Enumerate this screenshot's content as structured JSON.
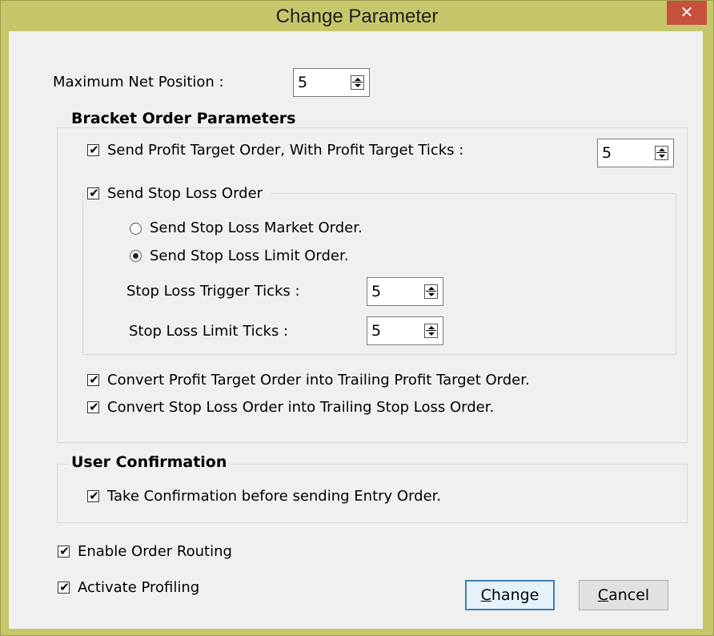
{
  "window": {
    "title": "Change Parameter",
    "close_glyph": "✕",
    "frame_color": "#c8c66a"
  },
  "max_net_position": {
    "label": "Maximum Net Position :",
    "value": "5"
  },
  "bracket": {
    "legend": "Bracket Order Parameters",
    "profit_target": {
      "label": "Send Profit Target Order, With Profit Target Ticks :",
      "checked": true,
      "ticks": "5"
    },
    "stop_loss": {
      "label": "Send Stop Loss Order",
      "checked": true,
      "market_label": "Send Stop Loss Market Order.",
      "market_selected": false,
      "limit_label": "Send Stop Loss Limit Order.",
      "limit_selected": true,
      "trigger_label": "Stop Loss Trigger Ticks :",
      "trigger_value": "5",
      "limit_ticks_label": "Stop Loss Limit Ticks :",
      "limit_ticks_value": "5"
    },
    "trailing_profit": {
      "label": "Convert Profit Target Order into Trailing Profit Target Order.",
      "checked": true
    },
    "trailing_stop": {
      "label": "Convert Stop Loss Order into Trailing Stop Loss Order.",
      "checked": true
    }
  },
  "confirmation": {
    "legend": "User Confirmation",
    "entry": {
      "label": "Take Confirmation before sending Entry Order.",
      "checked": true
    }
  },
  "enable_routing": {
    "label": "Enable Order Routing",
    "checked": true
  },
  "activate_profiling": {
    "label": "Activate Profiling",
    "checked": true
  },
  "buttons": {
    "change_mnemonic": "C",
    "change_rest": "hange",
    "cancel_mnemonic": "C",
    "cancel_rest": "ancel"
  },
  "check_glyph": "✔"
}
